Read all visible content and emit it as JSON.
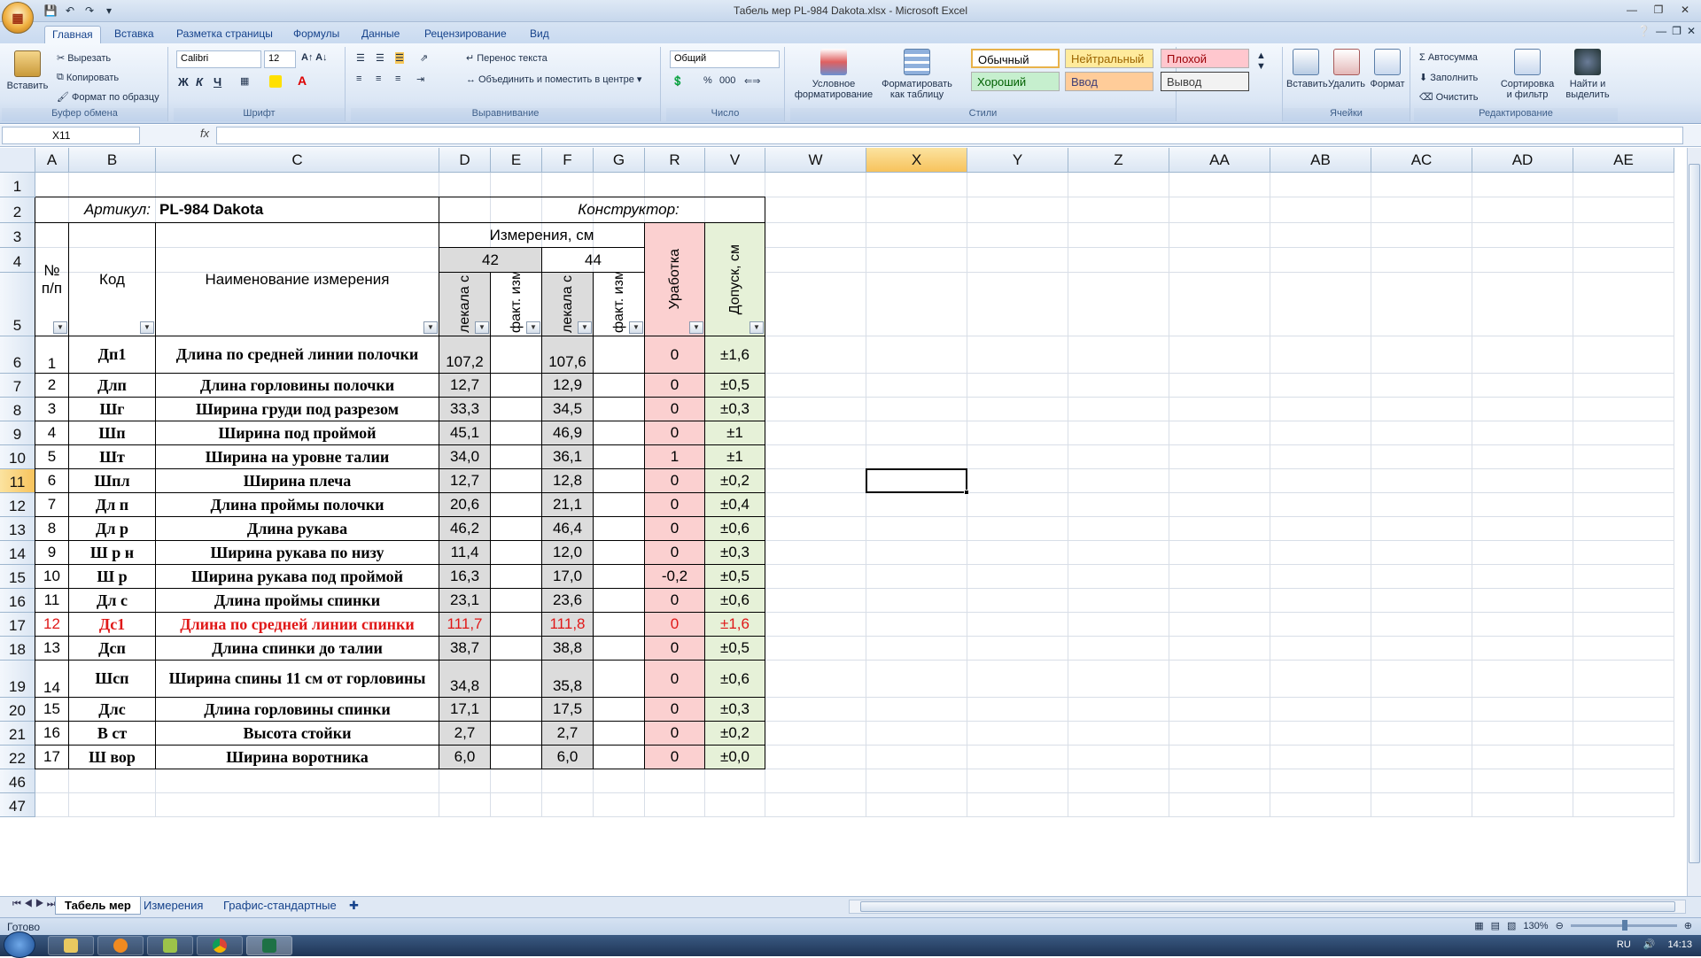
{
  "window": {
    "title": "Табель мер PL-984 Dakota.xlsx - Microsoft Excel",
    "office_button": "Office"
  },
  "ribbon": {
    "tabs": [
      "Главная",
      "Вставка",
      "Разметка страницы",
      "Формулы",
      "Данные",
      "Рецензирование",
      "Вид"
    ],
    "clipboard": {
      "paste": "Вставить",
      "cut": "Вырезать",
      "copy": "Копировать",
      "format_painter": "Формат по образцу",
      "label": "Буфер обмена"
    },
    "font": {
      "name": "Calibri",
      "size": "12",
      "label": "Шрифт",
      "bold": "Ж",
      "italic": "К",
      "underline": "Ч"
    },
    "alignment": {
      "wrap": "Перенос текста",
      "merge": "Объединить и поместить в центре",
      "label": "Выравнивание"
    },
    "number": {
      "format": "Общий",
      "label": "Число",
      "percent": "%",
      "thousands": "000"
    },
    "styles": {
      "conditional": "Условное форматирование",
      "as_table": "Форматировать как таблицу",
      "normal": "Обычный",
      "neutral": "Нейтральный",
      "bad": "Плохой",
      "good": "Хороший",
      "input": "Ввод",
      "output": "Вывод",
      "label": "Стили"
    },
    "cells": {
      "insert": "Вставить",
      "delete": "Удалить",
      "format": "Формат",
      "label": "Ячейки"
    },
    "editing": {
      "autosum": "Автосумма",
      "fill": "Заполнить",
      "clear": "Очистить",
      "sort": "Сортировка и фильтр",
      "find": "Найти и выделить",
      "label": "Редактирование"
    }
  },
  "formula_bar": {
    "name_box": "X11",
    "fx": "fx",
    "content": ""
  },
  "grid": {
    "columns": [
      "A",
      "B",
      "C",
      "D",
      "E",
      "F",
      "G",
      "R",
      "V",
      "W",
      "X",
      "Y",
      "Z",
      "AA",
      "AB",
      "AC",
      "AD",
      "AE"
    ],
    "rows": [
      "1",
      "2",
      "3",
      "4",
      "5",
      "6",
      "7",
      "8",
      "9",
      "10",
      "11",
      "12",
      "13",
      "14",
      "15",
      "16",
      "17",
      "18",
      "19",
      "20",
      "21",
      "22",
      "46",
      "47"
    ],
    "selected_col": "X",
    "selected_row": "11"
  },
  "table": {
    "article_label": "Артикул:",
    "article_value": "PL-984 Dakota",
    "designer_label": "Конструктор:",
    "measurements_header": "Измерения, см",
    "size_42": "42",
    "size_44": "44",
    "h_num": "№ п/п",
    "h_code": "Код",
    "h_name": "Наименование измерения",
    "h_pattern": "лекала с урабо",
    "h_actual": "факт. измере",
    "h_shrink": "Уработка",
    "h_tol": "Допуск, см",
    "rows": [
      {
        "n": "1",
        "code": "Дп1",
        "name": "Длина по средней линии полочки",
        "d": "107,2",
        "f": "107,6",
        "r": "0",
        "v": "±1,6",
        "red": false
      },
      {
        "n": "2",
        "code": "Длп",
        "name": "Длина горловины полочки",
        "d": "12,7",
        "f": "12,9",
        "r": "0",
        "v": "±0,5",
        "red": false
      },
      {
        "n": "3",
        "code": "Шг",
        "name": "Ширина груди под разрезом",
        "d": "33,3",
        "f": "34,5",
        "r": "0",
        "v": "±0,3",
        "red": false
      },
      {
        "n": "4",
        "code": "Шп",
        "name": "Ширина под проймой",
        "d": "45,1",
        "f": "46,9",
        "r": "0",
        "v": "±1",
        "red": false
      },
      {
        "n": "5",
        "code": "Шт",
        "name": "Ширина на уровне талии",
        "d": "34,0",
        "f": "36,1",
        "r": "1",
        "v": "±1",
        "red": false
      },
      {
        "n": "6",
        "code": "Шпл",
        "name": "Ширина плеча",
        "d": "12,7",
        "f": "12,8",
        "r": "0",
        "v": "±0,2",
        "red": false
      },
      {
        "n": "7",
        "code": "Дл п",
        "name": "Длина проймы полочки",
        "d": "20,6",
        "f": "21,1",
        "r": "0",
        "v": "±0,4",
        "red": false
      },
      {
        "n": "8",
        "code": "Дл р",
        "name": "Длина рукава",
        "d": "46,2",
        "f": "46,4",
        "r": "0",
        "v": "±0,6",
        "red": false
      },
      {
        "n": "9",
        "code": "Ш р н",
        "name": "Ширина рукава по  низу",
        "d": "11,4",
        "f": "12,0",
        "r": "0",
        "v": "±0,3",
        "red": false
      },
      {
        "n": "10",
        "code": "Ш р",
        "name": "Ширина рукава под проймой",
        "d": "16,3",
        "f": "17,0",
        "r": "-0,2",
        "v": "±0,5",
        "red": false
      },
      {
        "n": "11",
        "code": "Дл с",
        "name": "Длина проймы спинки",
        "d": "23,1",
        "f": "23,6",
        "r": "0",
        "v": "±0,6",
        "red": false
      },
      {
        "n": "12",
        "code": "Дс1",
        "name": "Длина по средней линии спинки",
        "d": "111,7",
        "f": "111,8",
        "r": "0",
        "v": "±1,6",
        "red": true
      },
      {
        "n": "13",
        "code": "Дсп",
        "name": "Длина спинки до талии",
        "d": "38,7",
        "f": "38,8",
        "r": "0",
        "v": "±0,5",
        "red": false
      },
      {
        "n": "14",
        "code": "Шсп",
        "name": "Ширина спины 11 см от горловины",
        "d": "34,8",
        "f": "35,8",
        "r": "0",
        "v": "±0,6",
        "red": false
      },
      {
        "n": "15",
        "code": "Длс",
        "name": "Длина горловины спинки",
        "d": "17,1",
        "f": "17,5",
        "r": "0",
        "v": "±0,3",
        "red": false
      },
      {
        "n": "16",
        "code": "В ст",
        "name": "Высота стойки",
        "d": "2,7",
        "f": "2,7",
        "r": "0",
        "v": "±0,2",
        "red": false
      },
      {
        "n": "17",
        "code": "Ш вор",
        "name": "Ширина воротника",
        "d": "6,0",
        "f": "6,0",
        "r": "0",
        "v": "±0,0",
        "red": false
      }
    ]
  },
  "sheet_tabs": [
    "Табель мер",
    "Измерения",
    "Графис-стандартные"
  ],
  "status": {
    "ready": "Готово",
    "zoom": "130%"
  },
  "taskbar": {
    "lang": "RU",
    "time": "14:13"
  }
}
